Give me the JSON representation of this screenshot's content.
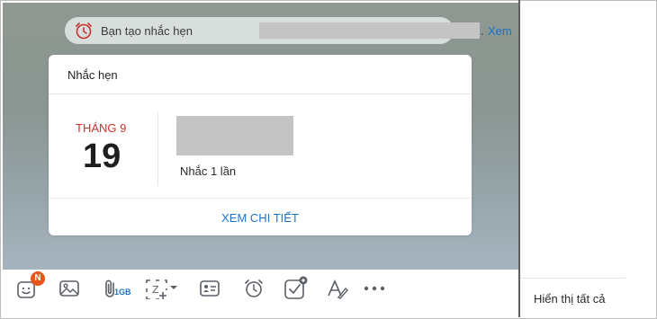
{
  "notification": {
    "text": "Bạn tạo nhắc hẹn",
    "dot": ".",
    "link": "Xem"
  },
  "reminder": {
    "title": "Nhắc hẹn",
    "month": "THÁNG 9",
    "day": "19",
    "repeat": "Nhắc 1 lần",
    "detail": "XEM CHI TIẾT"
  },
  "toolbar": {
    "badge": "N",
    "file_size": "1GB",
    "icons": [
      "sticker-icon",
      "image-icon",
      "attachment-icon",
      "screenshot-icon",
      "contact-card-icon",
      "alarm-icon",
      "task-icon",
      "format-text-icon",
      "more-icon"
    ]
  },
  "sidebar": {
    "show_all": "Hiển thị tất cả"
  },
  "colors": {
    "accent": "#1a73c9",
    "alarm": "#c8322e",
    "badge": "#e8541b"
  }
}
